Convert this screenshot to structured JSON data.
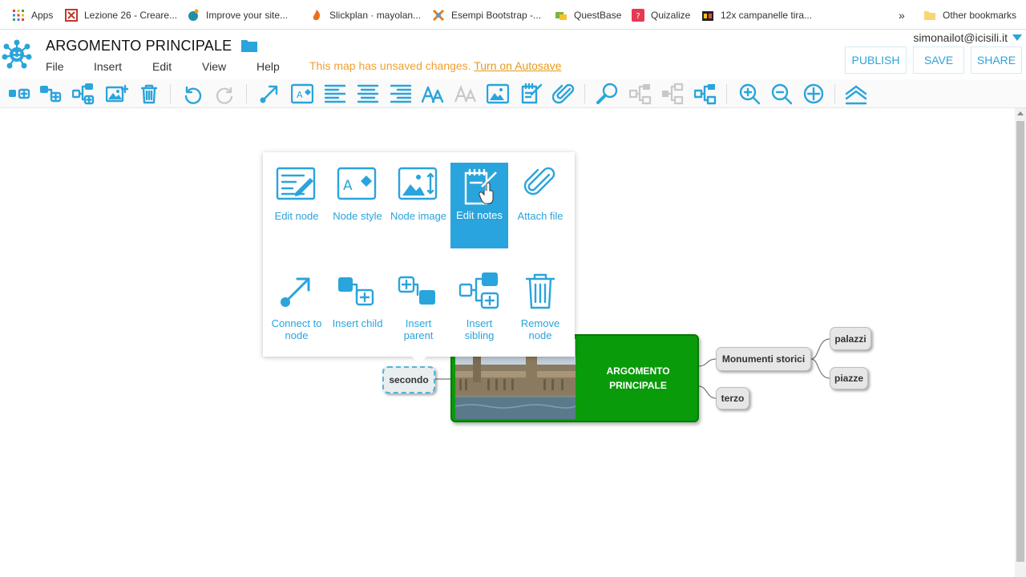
{
  "bookmarks": [
    {
      "label": "Apps",
      "icon": "apps-grid-icon"
    },
    {
      "label": "Lezione 26 - Creare...",
      "icon": "bookmark-favicon-icon"
    },
    {
      "label": "Improve your site...",
      "icon": "bookmark-favicon-icon"
    },
    {
      "label": "Slickplan · mayolan...",
      "icon": "bookmark-favicon-icon"
    },
    {
      "label": "Esempi Bootstrap -...",
      "icon": "bookmark-favicon-icon"
    },
    {
      "label": "QuestBase",
      "icon": "bookmark-favicon-icon"
    },
    {
      "label": "Quizalize",
      "icon": "bookmark-favicon-icon"
    },
    {
      "label": "12x campanelle tira...",
      "icon": "bookmark-favicon-icon"
    },
    {
      "label": "Other bookmarks",
      "icon": "folder-icon"
    }
  ],
  "bookmarks_more": "»",
  "header": {
    "title": "ARGOMENTO PRINCIPALE",
    "menu": [
      "File",
      "Insert",
      "Edit",
      "View",
      "Help"
    ],
    "unsaved_text": "This map has unsaved changes.",
    "autosave_link": "Turn on Autosave",
    "user": "simonailot@icisili.it",
    "buttons": {
      "publish": "PUBLISH",
      "save": "SAVE",
      "share": "SHARE"
    }
  },
  "toolbar": {
    "tools": [
      "add-child-icon",
      "add-node-icon",
      "add-sibling-icon",
      "add-image-icon",
      "delete-icon",
      "undo-icon",
      "redo-icon",
      "connect-icon",
      "node-style-icon",
      "align-left-icon",
      "align-center-icon",
      "align-right-icon",
      "font-size-up-icon",
      "font-size-down-icon",
      "node-image-icon",
      "notes-icon",
      "attach-icon",
      "search-icon",
      "collapse-icon",
      "expand-icon",
      "layout-icon",
      "zoom-in-icon",
      "zoom-out-icon",
      "center-icon",
      "collapse-all-icon"
    ]
  },
  "popup": {
    "items": [
      {
        "label": "Edit node",
        "icon": "edit-node-icon"
      },
      {
        "label": "Node style",
        "icon": "node-style-icon"
      },
      {
        "label": "Node image",
        "icon": "node-image-icon"
      },
      {
        "label": "Edit notes",
        "icon": "edit-notes-icon",
        "active": true
      },
      {
        "label": "Attach file",
        "icon": "attach-file-icon"
      },
      {
        "label": "Connect to node",
        "icon": "connect-icon"
      },
      {
        "label": "Insert child",
        "icon": "insert-child-icon"
      },
      {
        "label": "Insert parent",
        "icon": "insert-parent-icon"
      },
      {
        "label": "Insert sibling",
        "icon": "insert-sibling-icon"
      },
      {
        "label": "Remove node",
        "icon": "remove-node-icon"
      }
    ]
  },
  "mindmap": {
    "central": {
      "line1": "ARGOMENTO",
      "line2": "PRINCIPALE",
      "color": "#0a9b0a"
    },
    "nodes": {
      "secondo": "secondo",
      "monumenti": "Monumenti storici",
      "terzo": "terzo",
      "palazzi": "palazzi",
      "piazze": "piazze"
    }
  },
  "colors": {
    "accent": "#2aa4dc",
    "warning": "#f0a030"
  }
}
